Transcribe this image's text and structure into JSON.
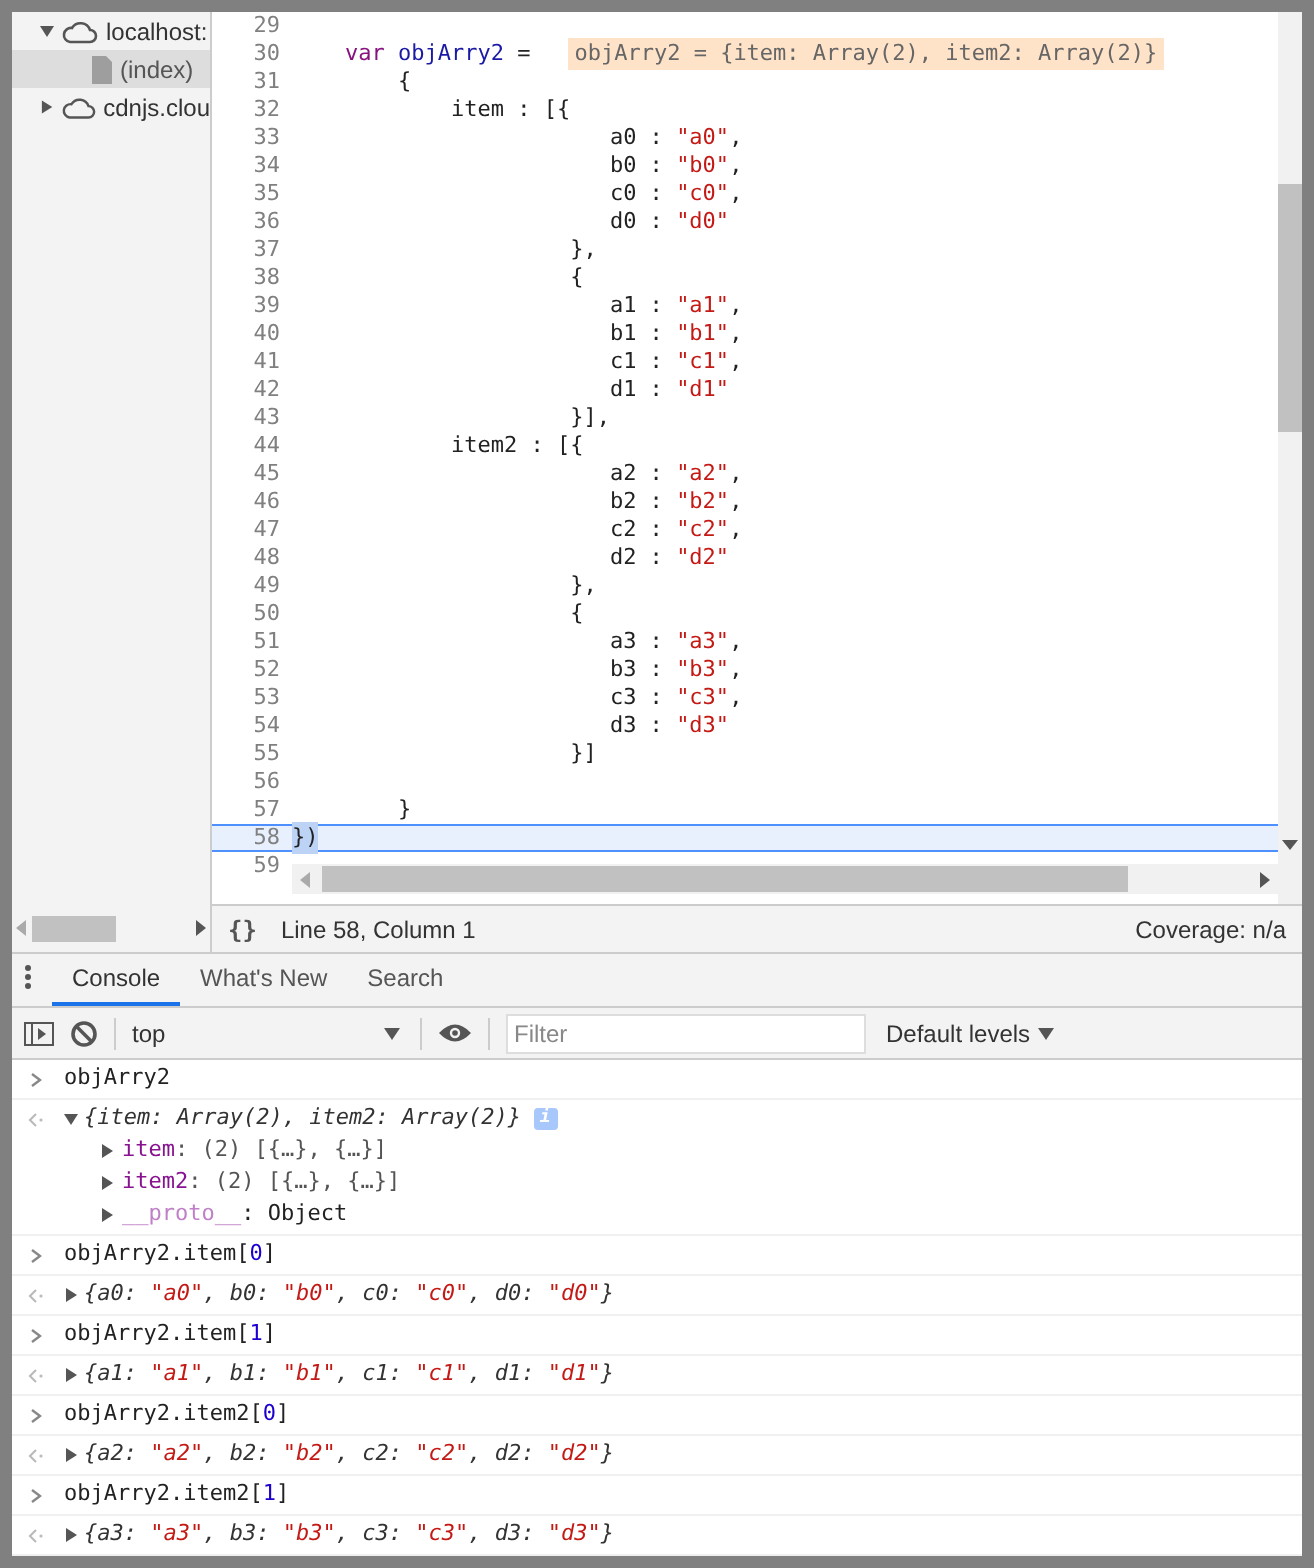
{
  "sidebar": {
    "items": [
      {
        "label": "localhost:",
        "kind": "domain",
        "expanded": true,
        "children": [
          {
            "label": "(index)",
            "kind": "file",
            "selected": true
          }
        ]
      },
      {
        "label": "cdnjs.clou",
        "kind": "domain",
        "expanded": false
      }
    ]
  },
  "editor": {
    "lines": [
      {
        "num": "29",
        "selected": false
      },
      {
        "num": "30",
        "selected": false,
        "segments": [
          {
            "text": "    var ",
            "kind": "keyword"
          },
          {
            "text": "objArry2",
            "kind": "variable"
          },
          {
            "text": " ="
          }
        ],
        "inline_value": "objArry2 = {item: Array(2), item2: Array(2)}"
      },
      {
        "num": "31",
        "selected": false,
        "segments": [
          {
            "text": "        {"
          }
        ]
      },
      {
        "num": "32",
        "selected": false,
        "segments": [
          {
            "text": "            item : [{"
          }
        ]
      },
      {
        "num": "33",
        "selected": false,
        "segments": [
          {
            "text": "                        a0 : "
          },
          {
            "text": "\"a0\"",
            "kind": "string"
          },
          {
            "text": ","
          }
        ]
      },
      {
        "num": "34",
        "selected": false,
        "segments": [
          {
            "text": "                        b0 : "
          },
          {
            "text": "\"b0\"",
            "kind": "string"
          },
          {
            "text": ","
          }
        ]
      },
      {
        "num": "35",
        "selected": false,
        "segments": [
          {
            "text": "                        c0 : "
          },
          {
            "text": "\"c0\"",
            "kind": "string"
          },
          {
            "text": ","
          }
        ]
      },
      {
        "num": "36",
        "selected": false,
        "segments": [
          {
            "text": "                        d0 : "
          },
          {
            "text": "\"d0\"",
            "kind": "string"
          }
        ]
      },
      {
        "num": "37",
        "selected": false,
        "segments": [
          {
            "text": "                     },"
          }
        ]
      },
      {
        "num": "38",
        "selected": false,
        "segments": [
          {
            "text": "                     {"
          }
        ]
      },
      {
        "num": "39",
        "selected": false,
        "segments": [
          {
            "text": "                        a1 : "
          },
          {
            "text": "\"a1\"",
            "kind": "string"
          },
          {
            "text": ","
          }
        ]
      },
      {
        "num": "40",
        "selected": false,
        "segments": [
          {
            "text": "                        b1 : "
          },
          {
            "text": "\"b1\"",
            "kind": "string"
          },
          {
            "text": ","
          }
        ]
      },
      {
        "num": "41",
        "selected": false,
        "segments": [
          {
            "text": "                        c1 : "
          },
          {
            "text": "\"c1\"",
            "kind": "string"
          },
          {
            "text": ","
          }
        ]
      },
      {
        "num": "42",
        "selected": false,
        "segments": [
          {
            "text": "                        d1 : "
          },
          {
            "text": "\"d1\"",
            "kind": "string"
          }
        ]
      },
      {
        "num": "43",
        "selected": false,
        "segments": [
          {
            "text": "                     }],"
          }
        ]
      },
      {
        "num": "44",
        "selected": false,
        "segments": [
          {
            "text": "            item2 : [{"
          }
        ]
      },
      {
        "num": "45",
        "selected": false,
        "segments": [
          {
            "text": "                        a2 : "
          },
          {
            "text": "\"a2\"",
            "kind": "string"
          },
          {
            "text": ","
          }
        ]
      },
      {
        "num": "46",
        "selected": false,
        "segments": [
          {
            "text": "                        b2 : "
          },
          {
            "text": "\"b2\"",
            "kind": "string"
          },
          {
            "text": ","
          }
        ]
      },
      {
        "num": "47",
        "selected": false,
        "segments": [
          {
            "text": "                        c2 : "
          },
          {
            "text": "\"c2\"",
            "kind": "string"
          },
          {
            "text": ","
          }
        ]
      },
      {
        "num": "48",
        "selected": false,
        "segments": [
          {
            "text": "                        d2 : "
          },
          {
            "text": "\"d2\"",
            "kind": "string"
          }
        ]
      },
      {
        "num": "49",
        "selected": false,
        "segments": [
          {
            "text": "                     },"
          }
        ]
      },
      {
        "num": "50",
        "selected": false,
        "segments": [
          {
            "text": "                     {"
          }
        ]
      },
      {
        "num": "51",
        "selected": false,
        "segments": [
          {
            "text": "                        a3 : "
          },
          {
            "text": "\"a3\"",
            "kind": "string"
          },
          {
            "text": ","
          }
        ]
      },
      {
        "num": "52",
        "selected": false,
        "segments": [
          {
            "text": "                        b3 : "
          },
          {
            "text": "\"b3\"",
            "kind": "string"
          },
          {
            "text": ","
          }
        ]
      },
      {
        "num": "53",
        "selected": false,
        "segments": [
          {
            "text": "                        c3 : "
          },
          {
            "text": "\"c3\"",
            "kind": "string"
          },
          {
            "text": ","
          }
        ]
      },
      {
        "num": "54",
        "selected": false,
        "segments": [
          {
            "text": "                        d3 : "
          },
          {
            "text": "\"d3\"",
            "kind": "string"
          }
        ]
      },
      {
        "num": "55",
        "selected": false,
        "segments": [
          {
            "text": "                     }]"
          }
        ]
      },
      {
        "num": "56",
        "selected": false
      },
      {
        "num": "57",
        "selected": false,
        "segments": [
          {
            "text": "        }"
          }
        ]
      },
      {
        "num": "58",
        "selected": true,
        "segments": [
          {
            "text": "})"
          }
        ]
      },
      {
        "num": "59",
        "selected": false
      }
    ]
  },
  "status_bar": {
    "pretty_print": "{}",
    "position": "Line 58, Column 1",
    "coverage": "Coverage: n/a"
  },
  "drawer": {
    "tabs": [
      {
        "label": "Console",
        "selected": true
      },
      {
        "label": "What's New",
        "selected": false
      },
      {
        "label": "Search",
        "selected": false
      }
    ]
  },
  "console_toolbar": {
    "context": "top",
    "filter_placeholder": "Filter",
    "levels": "Default levels"
  },
  "console": {
    "entries": [
      {
        "kind": "input",
        "segments": [
          {
            "text": "objArry2"
          }
        ]
      },
      {
        "kind": "output",
        "expanded": true,
        "segments": [
          {
            "text": "{item: Array(2), item2: Array(2)}"
          }
        ],
        "badge": "i",
        "children": [
          {
            "key": "item",
            "value": ": (2) [{…}, {…}]",
            "internal": false,
            "expanded": false
          },
          {
            "key": "item2",
            "value": ": (2) [{…}, {…}]",
            "internal": false,
            "expanded": false
          },
          {
            "key": "__proto__",
            "value": ": Object",
            "internal": true,
            "expanded": false
          }
        ]
      },
      {
        "kind": "input",
        "segments": [
          {
            "text": "objArry2.item["
          },
          {
            "text": "0",
            "kind": "number"
          },
          {
            "text": "]"
          }
        ]
      },
      {
        "kind": "output",
        "expanded": false,
        "segments": [
          {
            "text": "{a0: "
          },
          {
            "text": "\"a0\"",
            "kind": "string"
          },
          {
            "text": ", b0: "
          },
          {
            "text": "\"b0\"",
            "kind": "string"
          },
          {
            "text": ", c0: "
          },
          {
            "text": "\"c0\"",
            "kind": "string"
          },
          {
            "text": ", d0: "
          },
          {
            "text": "\"d0\"",
            "kind": "string"
          },
          {
            "text": "}"
          }
        ]
      },
      {
        "kind": "input",
        "segments": [
          {
            "text": "objArry2.item["
          },
          {
            "text": "1",
            "kind": "number"
          },
          {
            "text": "]"
          }
        ]
      },
      {
        "kind": "output",
        "expanded": false,
        "segments": [
          {
            "text": "{a1: "
          },
          {
            "text": "\"a1\"",
            "kind": "string"
          },
          {
            "text": ", b1: "
          },
          {
            "text": "\"b1\"",
            "kind": "string"
          },
          {
            "text": ", c1: "
          },
          {
            "text": "\"c1\"",
            "kind": "string"
          },
          {
            "text": ", d1: "
          },
          {
            "text": "\"d1\"",
            "kind": "string"
          },
          {
            "text": "}"
          }
        ]
      },
      {
        "kind": "input",
        "segments": [
          {
            "text": "objArry2.item2["
          },
          {
            "text": "0",
            "kind": "number"
          },
          {
            "text": "]"
          }
        ]
      },
      {
        "kind": "output",
        "expanded": false,
        "segments": [
          {
            "text": "{a2: "
          },
          {
            "text": "\"a2\"",
            "kind": "string"
          },
          {
            "text": ", b2: "
          },
          {
            "text": "\"b2\"",
            "kind": "string"
          },
          {
            "text": ", c2: "
          },
          {
            "text": "\"c2\"",
            "kind": "string"
          },
          {
            "text": ", d2: "
          },
          {
            "text": "\"d2\"",
            "kind": "string"
          },
          {
            "text": "}"
          }
        ]
      },
      {
        "kind": "input",
        "segments": [
          {
            "text": "objArry2.item2["
          },
          {
            "text": "1",
            "kind": "number"
          },
          {
            "text": "]"
          }
        ]
      },
      {
        "kind": "output",
        "expanded": false,
        "segments": [
          {
            "text": "{a3: "
          },
          {
            "text": "\"a3\"",
            "kind": "string"
          },
          {
            "text": ", b3: "
          },
          {
            "text": "\"b3\"",
            "kind": "string"
          },
          {
            "text": ", c3: "
          },
          {
            "text": "\"c3\"",
            "kind": "string"
          },
          {
            "text": ", d3: "
          },
          {
            "text": "\"d3\"",
            "kind": "string"
          },
          {
            "text": "}"
          }
        ]
      }
    ]
  }
}
